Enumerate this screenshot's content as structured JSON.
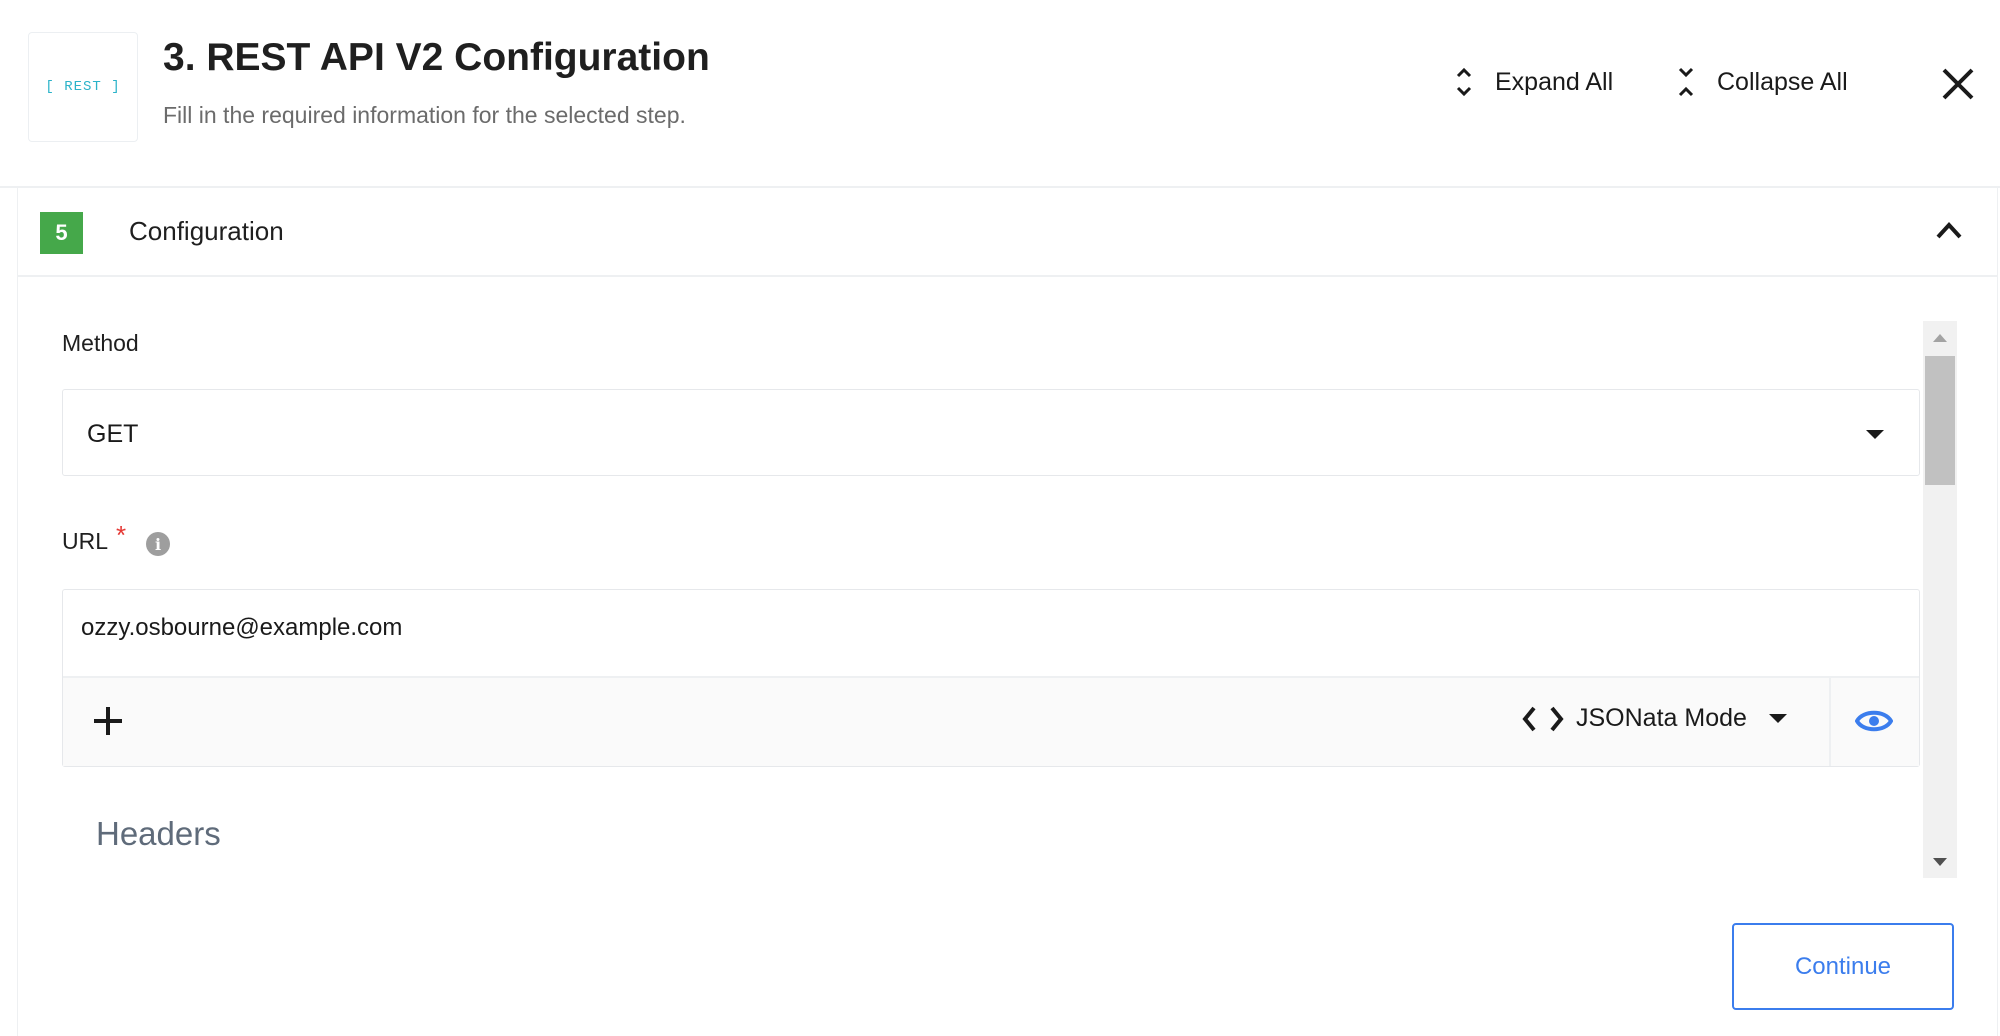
{
  "header": {
    "logo_text": "[ REST ]",
    "title": "3. REST API V2 Configuration",
    "subtitle": "Fill in the required information for the selected step.",
    "expand_all": "Expand All",
    "collapse_all": "Collapse All"
  },
  "section": {
    "number": "5",
    "title": "Configuration",
    "expanded": true,
    "badge_color": "#45a84a"
  },
  "form": {
    "method": {
      "label": "Method",
      "value": "GET"
    },
    "url": {
      "label": "URL",
      "required_mark": "*",
      "value": "ozzy.osbourne@example.com",
      "mode": "JSONata Mode"
    },
    "headers_label": "Headers"
  },
  "footer": {
    "continue_label": "Continue"
  },
  "colors": {
    "accent": "#3b7ded",
    "required": "#e53935"
  }
}
